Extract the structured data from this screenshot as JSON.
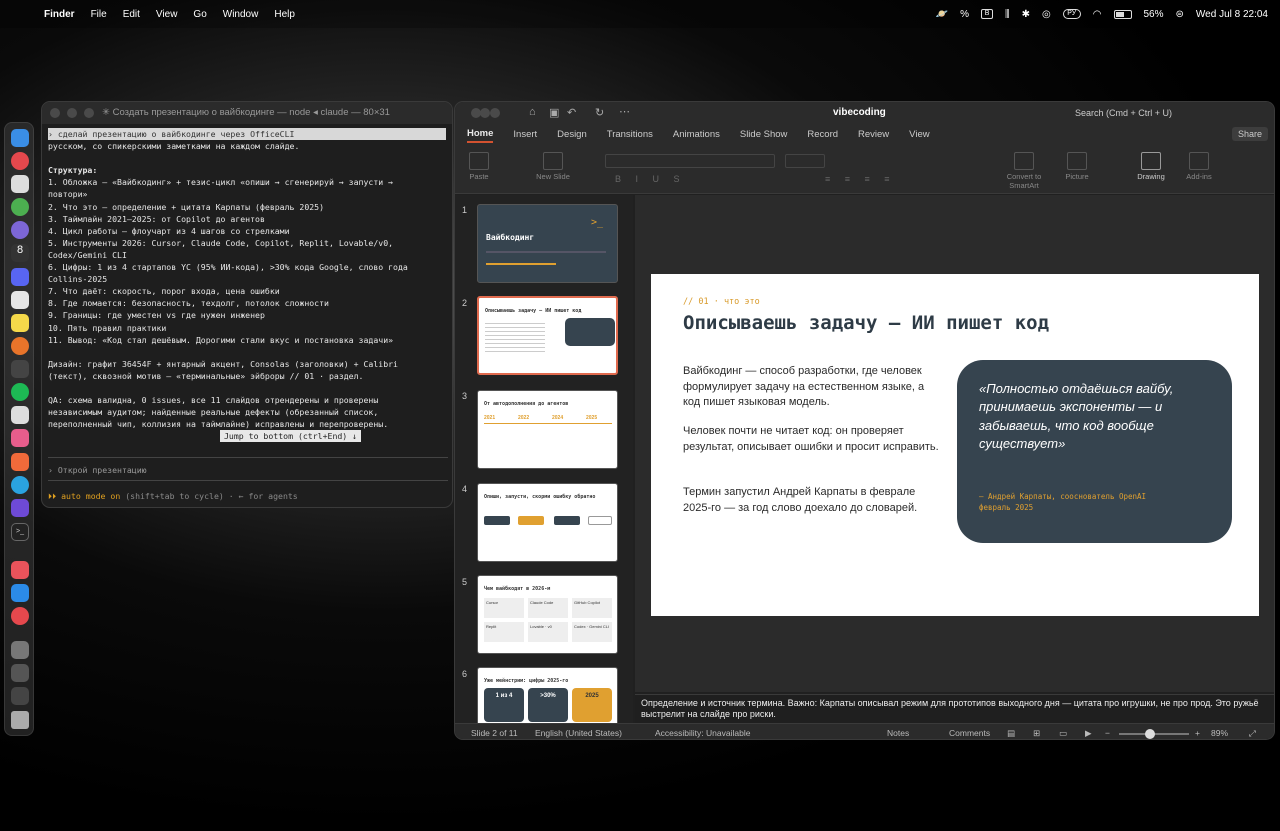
{
  "menubar": {
    "app": "Finder",
    "items": [
      "File",
      "Edit",
      "View",
      "Go",
      "Window",
      "Help"
    ],
    "input_source": "РУ",
    "battery": "56%",
    "datetime": "Wed Jul 8  22:04"
  },
  "terminal": {
    "title": "✳ Создать презентацию о вайбкодинге — node ◂ claude — 80×31",
    "lines": [
      "› сделай презентацию о вайбкодинге через OfficeCLI",
      "русском, со спикерскими заметками на каждом слайде.",
      "",
      "Структура:",
      "1. Обложка — «Вайбкодинг» + тезис-цикл «опиши → сгенерируй → запусти →",
      "повтори»",
      "2. Что это — определение + цитата Карпаты (февраль 2025)",
      "3. Таймлайн 2021–2025: от Copilot до агентов",
      "4. Цикл работы — флоучарт из 4 шагов со стрелками",
      "5. Инструменты 2026: Cursor, Claude Code, Copilot, Replit, Lovable/v0,",
      "Codex/Gemini CLI",
      "6. Цифры: 1 из 4 стартапов YC (95% ИИ-кода), >30% кода Google, слово года",
      "Collins-2025",
      "7. Что даёт: скорость, порог входа, цена ошибки",
      "8. Где ломается: безопасность, техдолг, потолок сложности",
      "9. Границы: где уместен vs где нужен инженер",
      "10. Пять правил практики",
      "11. Вывод: «Код стал дешёвым. Дорогими стали вкус и постановка задачи»",
      "",
      "Дизайн: графит 36454F + янтарный акцент, Consolas (заголовки) + Calibri",
      "(текст), сквозной мотив — «терминальные» эйброры // 01 · раздел.",
      "",
      "QA: схема валидна, 0 issues, все 11 слайдов отрендерены и проверены",
      "независимым аудитом; найденные реальные дефекты (обрезанный список,",
      "переполненный чип, коллизия на таймлайне) исправлены и перепроверены."
    ],
    "jump_label": "Jump to bottom (ctrl+End) ↓",
    "prompt": "› Открой презентацию",
    "auto_mode_prefix": "⏵⏵ auto mode on",
    "auto_mode_suffix": " (shift+tab to cycle) · ← for agents"
  },
  "ppt": {
    "doc_title": "vibecoding",
    "search": "Search (Cmd + Ctrl + U)",
    "tabs": [
      "Home",
      "Insert",
      "Design",
      "Transitions",
      "Animations",
      "Slide Show",
      "Record",
      "Review",
      "View"
    ],
    "share": "Share",
    "ribbon": {
      "paste": "Paste",
      "new_slide": "New Slide",
      "convert": "Convert to SmartArt",
      "picture": "Picture",
      "drawing": "Drawing",
      "addins": "Add-ins"
    },
    "thumbs": [
      {
        "num": "1",
        "title": "Вайбкодинг"
      },
      {
        "num": "2",
        "title": "Описываешь задачу — ИИ пишет код"
      },
      {
        "num": "3",
        "title": "От автодополнения до агентов",
        "years": [
          "2021",
          "2022",
          "2024",
          "2025"
        ]
      },
      {
        "num": "4",
        "title": "Опиши, запусти, скорми ошибку обратно"
      },
      {
        "num": "5",
        "title": "Чем вайбкодят в 2026-м",
        "tools": [
          "Cursor",
          "Claude Code",
          "GitHub Copilot",
          "Replit",
          "Lovable · v0",
          "Codex · Gemini CLI"
        ]
      },
      {
        "num": "6",
        "title": "Уже мейнстрим: цифры 2025-го",
        "stats": [
          "1 из 4",
          ">30%",
          "2025"
        ]
      }
    ],
    "slide": {
      "kicker": "// 01 · что это",
      "title": "Описываешь задачу — ИИ пишет код",
      "p1": "Вайбкодинг — способ разработки, где человек формулирует задачу на естественном языке, а код пишет языковая модель.",
      "p2": "Человек почти не читает код: он проверяет результат, описывает ошибки и просит исправить.",
      "p3": "Термин запустил Андрей Карпаты в феврале 2025-го — за год слово доехало до словарей.",
      "quote": "«Полностью отдаёшься вайбу, принимаешь экспоненты — и забываешь, что код вообще существует»",
      "attr1": "— Андрей Карпаты, сооснователь OpenAI",
      "attr2": "февраль 2025"
    },
    "notes": "Определение и источник термина. Важно: Карпаты описывал режим для прототипов выходного дня — цитата про игрушки, не про прод. Это ружьё выстрелит на слайде про риски.",
    "status": {
      "slide": "Slide 2 of 11",
      "lang": "English (United States)",
      "access": "Accessibility: Unavailable",
      "notes": "Notes",
      "comments": "Comments",
      "zoom": "89%"
    },
    "colors": {
      "graphite": "#36454F",
      "amber": "#E0A030",
      "accent": "#D35230"
    }
  }
}
